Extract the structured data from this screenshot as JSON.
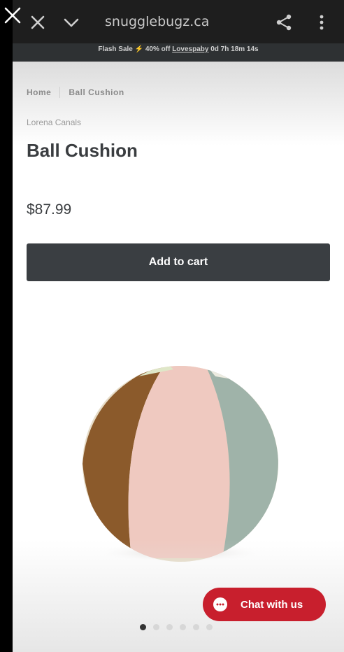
{
  "browser": {
    "url": "snugglebugz.ca"
  },
  "promo": {
    "bolt": "⚡",
    "text": "Flash Sale ⚡ 40% off",
    "code": "Lovespaby",
    "countdown": "0d 7h 18m 14s"
  },
  "breadcrumb": {
    "home": "Home",
    "current": "Ball Cushion"
  },
  "product": {
    "vendor": "Lorena Canals",
    "title": "Ball Cushion",
    "price": "$87.99",
    "add_to_cart": "Add to cart"
  },
  "chat": {
    "label": "Chat with us",
    "color": "#c81f2d"
  },
  "carousel": {
    "total": 6,
    "active_index": 0
  },
  "icons": {
    "overlay": "close-icon",
    "browser_close": "close-icon",
    "browser_collapse": "chevron-down-icon",
    "share": "share-icon",
    "menu": "more-vertical-icon",
    "chat": "chat-bubble-icon"
  }
}
